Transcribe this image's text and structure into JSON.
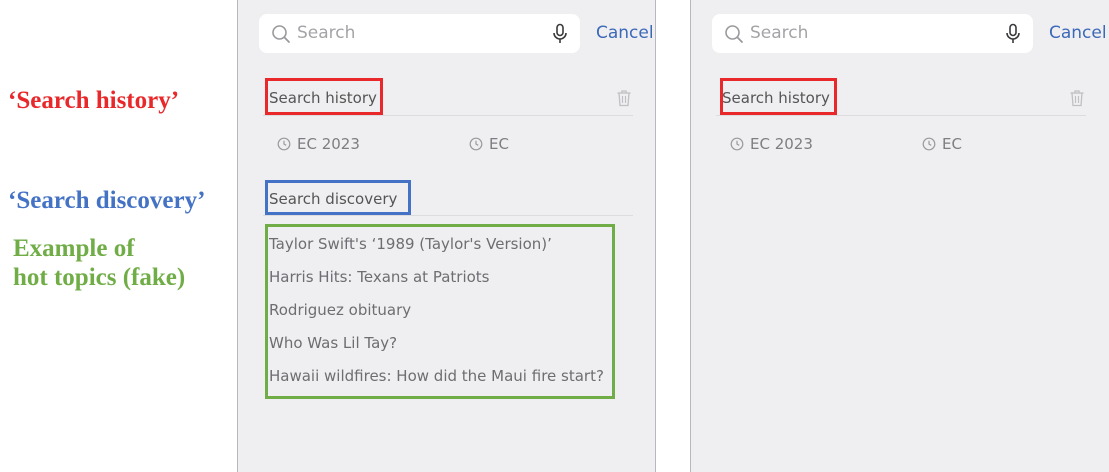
{
  "annotations": {
    "search_history": {
      "text": "‘Search history’",
      "color": "#e8282a"
    },
    "search_discovery": {
      "text": "‘Search discovery’",
      "color": "#4472c4"
    },
    "example_line1": {
      "text": "Example of",
      "color": "#70ad47"
    },
    "example_line2": {
      "text": "hot topics (fake)",
      "color": "#70ad47"
    }
  },
  "panels": {
    "left": {
      "search": {
        "placeholder": "Search",
        "cancel_label": "Cancel"
      },
      "history": {
        "title": "Search history",
        "items": [
          {
            "label": "EC 2023",
            "icon": "clock-icon"
          },
          {
            "label": "EC",
            "icon": "clock-icon"
          }
        ]
      },
      "discovery": {
        "title": "Search discovery",
        "topics": [
          "Taylor Swift's ‘1989 (Taylor's Version)’",
          "Harris Hits: Texans at Patriots",
          "Rodriguez obituary",
          "Who Was Lil Tay?",
          "Hawaii wildfires: How did the Maui fire start?"
        ]
      }
    },
    "right": {
      "search": {
        "placeholder": "Search",
        "cancel_label": "Cancel"
      },
      "history": {
        "title": "Search history",
        "items": [
          {
            "label": "EC 2023",
            "icon": "clock-icon"
          },
          {
            "label": "EC",
            "icon": "clock-icon"
          }
        ]
      }
    }
  },
  "colors": {
    "panel_background": "#efeff1",
    "accent_link": "#3c68b8",
    "highlight_history": "#e8282a",
    "highlight_discovery": "#4472c4",
    "highlight_topics": "#70ad47"
  }
}
